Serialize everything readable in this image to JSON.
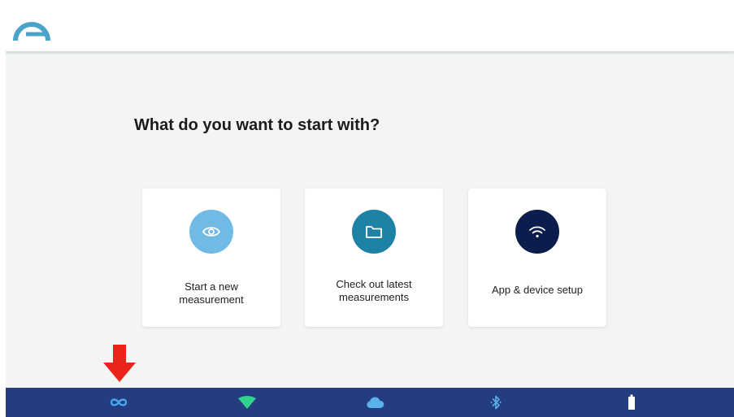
{
  "header": {
    "logo_icon": "brand-arc-logo-icon",
    "logo_color": "#4ba3c9"
  },
  "main": {
    "title": "What do you want to start with?",
    "cards": [
      {
        "label_lines": [
          "Start a new",
          "measurement"
        ],
        "icon": "eye-icon",
        "circle_color": "#6fbbe6"
      },
      {
        "label_lines": [
          "Check out latest",
          "measurements"
        ],
        "icon": "folder-icon",
        "circle_color": "#1e81a6"
      },
      {
        "label_lines": [
          "App & device setup"
        ],
        "icon": "wifi-icon",
        "circle_color": "#0c1d4d"
      }
    ]
  },
  "annotation": {
    "icon": "down-arrow-icon",
    "color": "#e8241b"
  },
  "status_bar": {
    "background": "#243d80",
    "icons": [
      {
        "name": "infinity-icon",
        "color": "#46a8ea"
      },
      {
        "name": "wifi-signal-icon",
        "color": "#2fd38f"
      },
      {
        "name": "cloud-icon",
        "color": "#5ab2ea"
      },
      {
        "name": "bluetooth-icon",
        "color": "#5ab2ea"
      },
      {
        "name": "battery-icon",
        "color": "#ffffff"
      }
    ]
  }
}
